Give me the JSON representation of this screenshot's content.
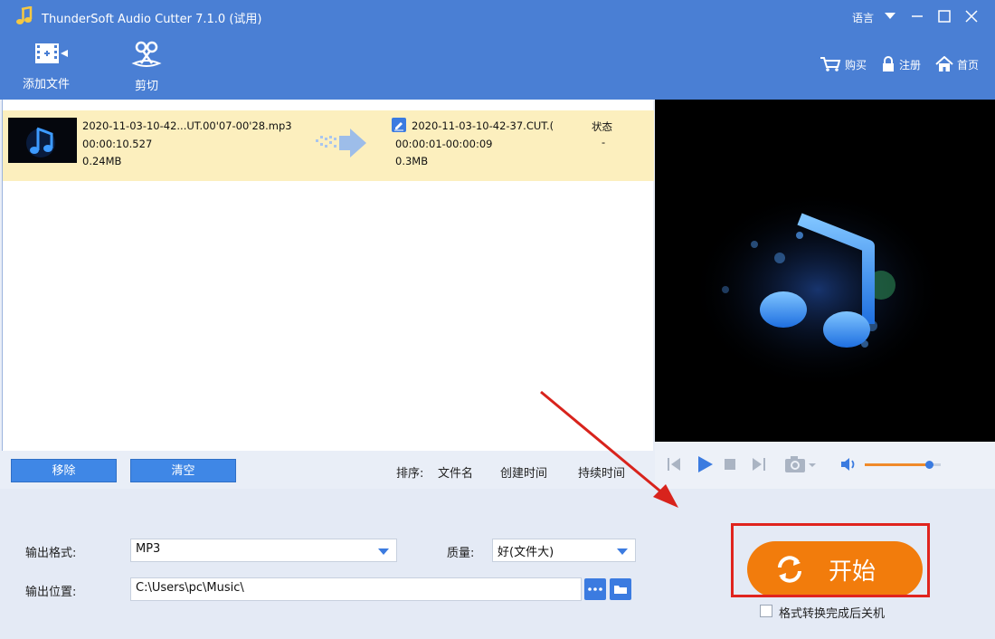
{
  "app": {
    "title": "ThunderSoft Audio Cutter 7.1.0 (试用)",
    "language_label": "语言"
  },
  "toolbar": {
    "add_file_label": "添加文件",
    "cut_label": "剪切",
    "buy_label": "购买",
    "register_label": "注册",
    "home_label": "首页"
  },
  "file_row": {
    "source_name": "2020-11-03-10-42...UT.00'07-00'28.mp3",
    "source_duration": "00:00:10.527",
    "source_size": "0.24MB",
    "output_name": "2020-11-03-10-42-37.CUT.(",
    "output_range": "00:00:01-00:00:09",
    "output_size": "0.3MB",
    "status_header": "状态",
    "status_value": "-"
  },
  "list_actions": {
    "remove_label": "移除",
    "clear_label": "清空"
  },
  "sort": {
    "label": "排序:",
    "by_name": "文件名",
    "by_created": "创建时间",
    "by_duration": "持续时间"
  },
  "settings": {
    "output_format_label": "输出格式:",
    "output_format_value": "MP3",
    "quality_label": "质量:",
    "quality_value": "好(文件大)",
    "output_location_label": "输出位置:",
    "output_location_value": "C:\\Users\\pc\\Music\\",
    "start_label": "开始",
    "shutdown_label": "格式转换完成后关机"
  },
  "player": {
    "volume_fraction": 0.85
  },
  "colors": {
    "titlebar": "#4a7fd4",
    "start_button": "#f27c0c",
    "highlight_row": "#fcefbe",
    "annotation_red": "#e0241e"
  }
}
